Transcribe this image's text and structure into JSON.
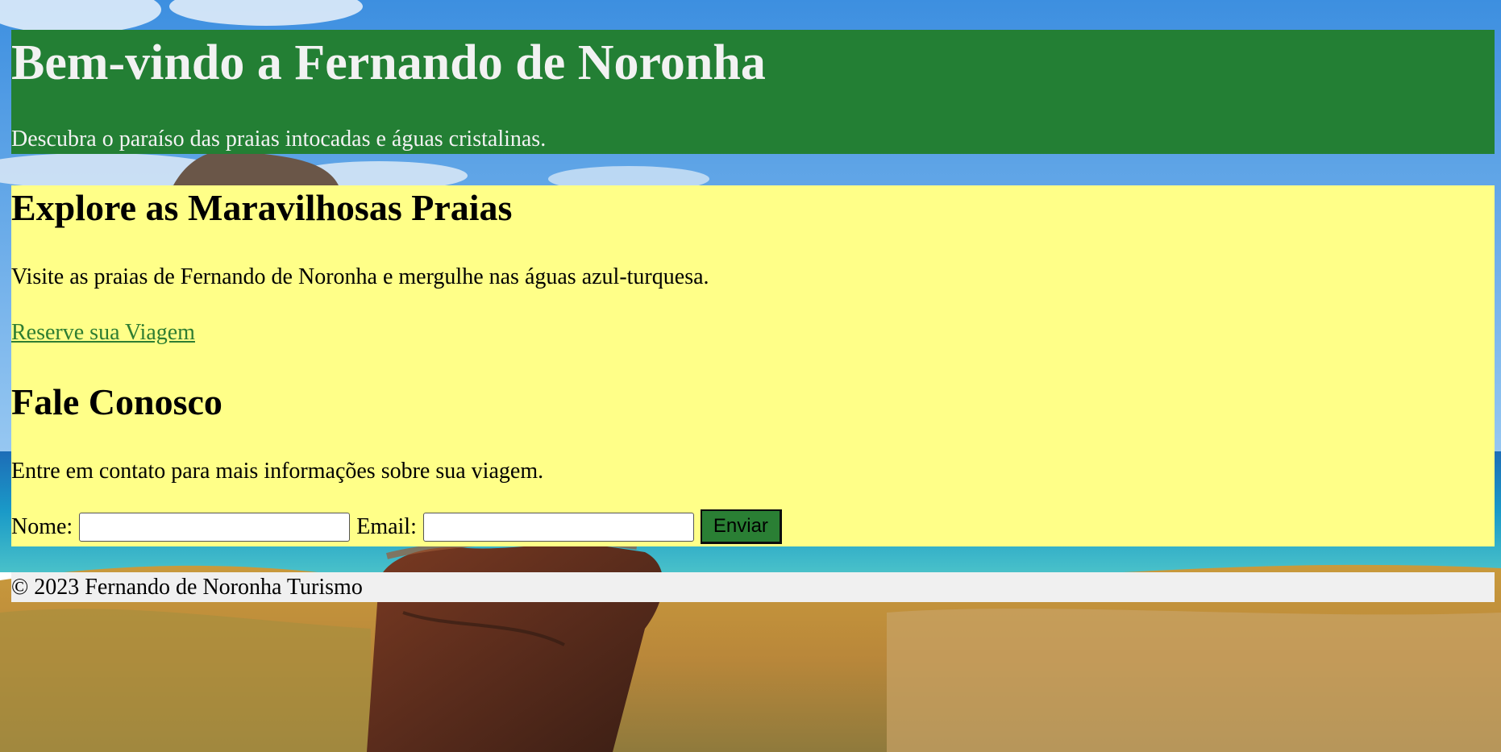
{
  "header": {
    "title": "Bem-vindo a Fernando de Noronha",
    "subtitle": "Descubra o paraíso das praias intocadas e águas cristalinas."
  },
  "beaches": {
    "heading": "Explore as Maravilhosas Praias",
    "text": "Visite as praias de Fernando de Noronha e mergulhe nas águas azul-turquesa.",
    "cta_label": "Reserve sua Viagem"
  },
  "contact": {
    "heading": "Fale Conosco",
    "text": "Entre em contato para mais informações sobre sua viagem.",
    "name_label": "Nome:",
    "name_value": "",
    "email_label": "Email:",
    "email_value": "",
    "submit_label": "Enviar"
  },
  "footer": {
    "copyright": "© 2023 Fernando de Noronha Turismo"
  },
  "colors": {
    "header_bg": "#237f34",
    "header_text": "#f2f2f2",
    "content_bg": "#ffff88",
    "link": "#2e7d32",
    "button_bg": "#2a7f34",
    "footer_bg": "#f0f0f0"
  }
}
